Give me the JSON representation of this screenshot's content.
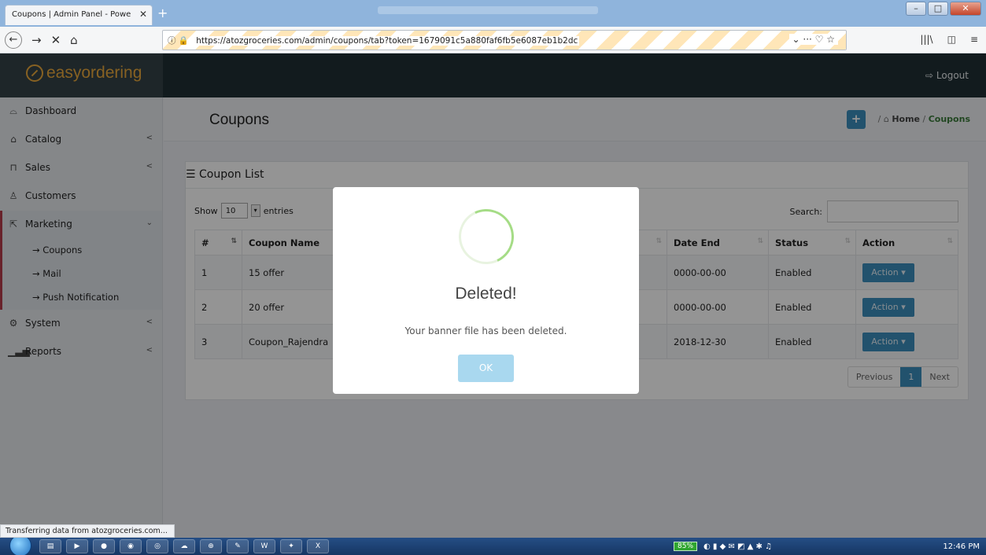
{
  "browser": {
    "tab_title": "Coupons | Admin Panel - Powe",
    "tab_close": "✕",
    "new_tab": "+",
    "url": "https://atozgroceries.com/admin/coupons/tab?token=1679091c5a880faf6fb5e6087eb1b2dc",
    "url_actions": "⌄ ··· ♡ ☆",
    "status_text": "Transferring data from atozgroceries.com..."
  },
  "app": {
    "brand": "easyordering",
    "logout_label": "Logout"
  },
  "sidebar": {
    "items": [
      {
        "label": "Dashboard",
        "icon": "dashboard-icon",
        "chevron": ""
      },
      {
        "label": "Catalog",
        "icon": "tag-icon",
        "chevron": "<"
      },
      {
        "label": "Sales",
        "icon": "cart-icon",
        "chevron": "<"
      },
      {
        "label": "Customers",
        "icon": "user-icon",
        "chevron": ""
      },
      {
        "label": "Marketing",
        "icon": "share-icon",
        "chevron": "⌄"
      }
    ],
    "submenu": [
      "Coupons",
      "Mail",
      "Push Notification"
    ],
    "items_after": [
      {
        "label": "System",
        "icon": "gear-icon",
        "chevron": "<"
      },
      {
        "label": "Reports",
        "icon": "chart-icon",
        "chevron": "<"
      }
    ]
  },
  "page": {
    "title": "Coupons",
    "breadcrumb_home": "Home",
    "breadcrumb_current": "Coupons",
    "breadcrumb_sep": "/"
  },
  "panel": {
    "title": "Coupon List",
    "show_label": "Show",
    "entries_value": "10",
    "entries_label": "entries",
    "search_label": "Search:"
  },
  "table": {
    "headers": [
      "#",
      "Coupon Name",
      "Date End",
      "Status",
      "Action"
    ],
    "rows": [
      {
        "num": "1",
        "name": "15 offer",
        "date_end": "0000-00-00",
        "status": "Enabled",
        "action": "Action ▾"
      },
      {
        "num": "2",
        "name": "20 offer",
        "date_end": "0000-00-00",
        "status": "Enabled",
        "action": "Action ▾"
      },
      {
        "num": "3",
        "name": "Coupon_Rajendra",
        "date_end": "2018-12-30",
        "status": "Enabled",
        "action": "Action ▾"
      }
    ]
  },
  "pager": {
    "previous": "Previous",
    "current": "1",
    "next": "Next"
  },
  "modal": {
    "title": "Deleted!",
    "text": "Your banner file has been deleted.",
    "ok_label": "OK"
  },
  "taskbar": {
    "battery": "85%",
    "clock": "12:46 PM"
  }
}
